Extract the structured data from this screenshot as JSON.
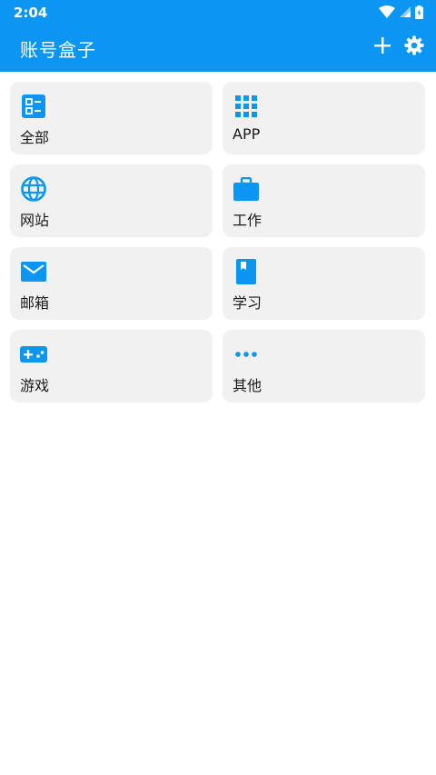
{
  "status_bar": {
    "time": "2:04"
  },
  "app_bar": {
    "title": "账号盒子",
    "add_icon": "plus-icon",
    "settings_icon": "gear-icon"
  },
  "colors": {
    "primary": "#0a96f2",
    "card_bg": "#f1f1f1",
    "text": "#1a1a1a"
  },
  "categories": [
    {
      "label": "全部",
      "icon": "dashboard-icon"
    },
    {
      "label": "APP",
      "icon": "apps-grid-icon"
    },
    {
      "label": "网站",
      "icon": "globe-icon"
    },
    {
      "label": "工作",
      "icon": "briefcase-icon"
    },
    {
      "label": "邮箱",
      "icon": "mail-icon"
    },
    {
      "label": "学习",
      "icon": "book-icon"
    },
    {
      "label": "游戏",
      "icon": "gamepad-icon"
    },
    {
      "label": "其他",
      "icon": "more-dots-icon"
    }
  ]
}
